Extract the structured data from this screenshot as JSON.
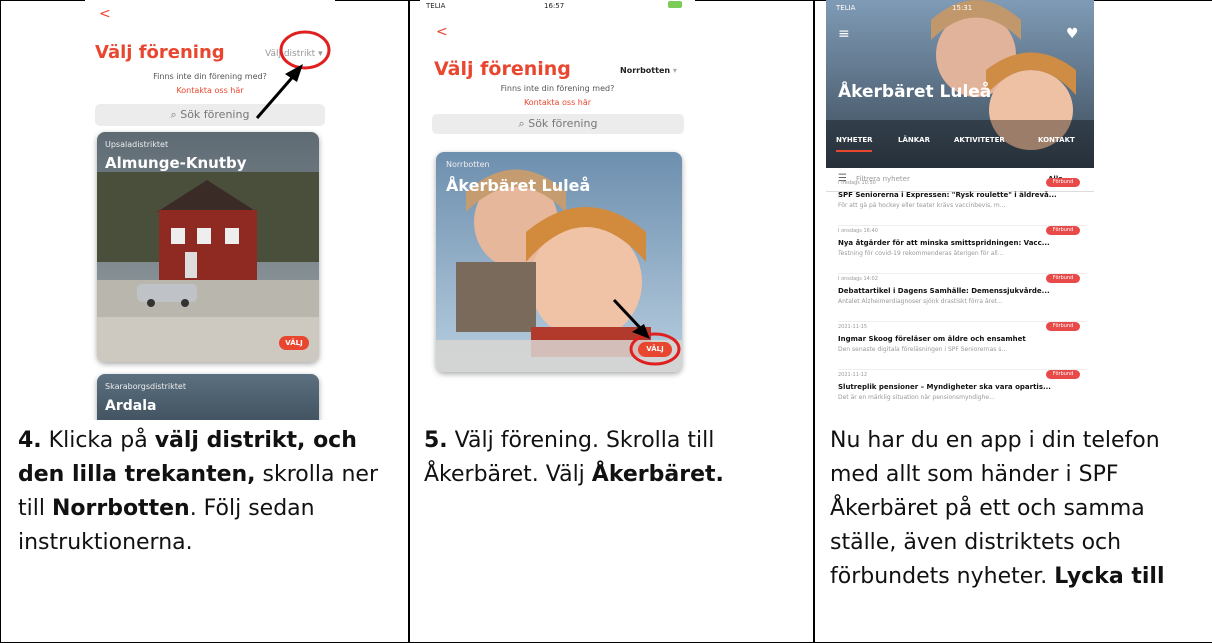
{
  "columns": [
    {
      "phone": {
        "back": "<",
        "title": "Välj förening",
        "district_selector": "Välj distrikt",
        "not_found_text": "Finns inte din förening med?",
        "contact_link": "Kontakta oss här",
        "search_placeholder": "Sök förening",
        "cards": [
          {
            "district": "Upsaladistriktet",
            "name": "Almunge-Knutby",
            "button": "VÄLJ"
          },
          {
            "district": "Skaraborgsdistriktet",
            "name": "Ardala"
          }
        ]
      },
      "caption": {
        "number": "4.",
        "t1": " Klicka på ",
        "b1": "välj distrikt, och den lilla trekanten,",
        "t2": " skrolla ner till ",
        "b2": "Norrbotten",
        "t3": ". Följ sedan instruktionerna."
      }
    },
    {
      "phone": {
        "carrier": "TELIA",
        "time": "16:57",
        "back": "<",
        "title": "Välj förening",
        "district_selector": "Norrbotten",
        "not_found_text": "Finns inte din förening med?",
        "contact_link": "Kontakta oss här",
        "search_placeholder": "Sök förening",
        "card": {
          "district": "Norrbotten",
          "name": "Åkerbäret Luleå",
          "button": "VÄLJ"
        }
      },
      "caption": {
        "number": "5.",
        "t1": " Välj förening. Skrolla till Åkerbäret. Välj ",
        "b1": "Åkerbäret."
      }
    },
    {
      "phone": {
        "carrier": "TELIA",
        "time": "15:31",
        "title": "Åkerbäret Luleå",
        "tabs": [
          "NYHETER",
          "LÄNKAR",
          "AKTIVITETER",
          "KONTAKT"
        ],
        "filter_label": "Filtrera nyheter",
        "filter_value": "Alla",
        "news": [
          {
            "date": "I fredags 10:50",
            "badge": "Förbund",
            "title": "SPF Seniorerna i Expressen: \"Rysk roulette\" i äldrevå...",
            "sub": "För att gå på hockey eller teater krävs vaccinbevis, m..."
          },
          {
            "date": "I onsdags 16:40",
            "badge": "Förbund",
            "title": "Nya åtgärder för att minska smittspridningen: Vacc...",
            "sub": "Testning för covid-19 rekommenderas återigen för all..."
          },
          {
            "date": "I onsdags 14:02",
            "badge": "Förbund",
            "title": "Debattartikel i Dagens Samhälle: Demenssjukvårde...",
            "sub": "Antalet Alzheimerdiagnoser sjönk drastiskt förra året..."
          },
          {
            "date": "2021-11-15",
            "badge": "Förbund",
            "title": "Ingmar Skoog föreläser om äldre och ensamhet",
            "sub": "Den senaste digitala föreläsningen i SPF Seniorernas s..."
          },
          {
            "date": "2021-11-12",
            "badge": "Förbund",
            "title": "Slutreplik pensioner – Myndigheter ska vara opartis...",
            "sub": "Det är en märklig situation när pensionsmyndighe..."
          }
        ]
      },
      "caption": {
        "t1": "Nu har du en app i din telefon med allt som händer i SPF Åkerbäret på ett och samma ställe, även distriktets och förbundets nyheter. ",
        "b1": "Lycka till"
      }
    }
  ]
}
